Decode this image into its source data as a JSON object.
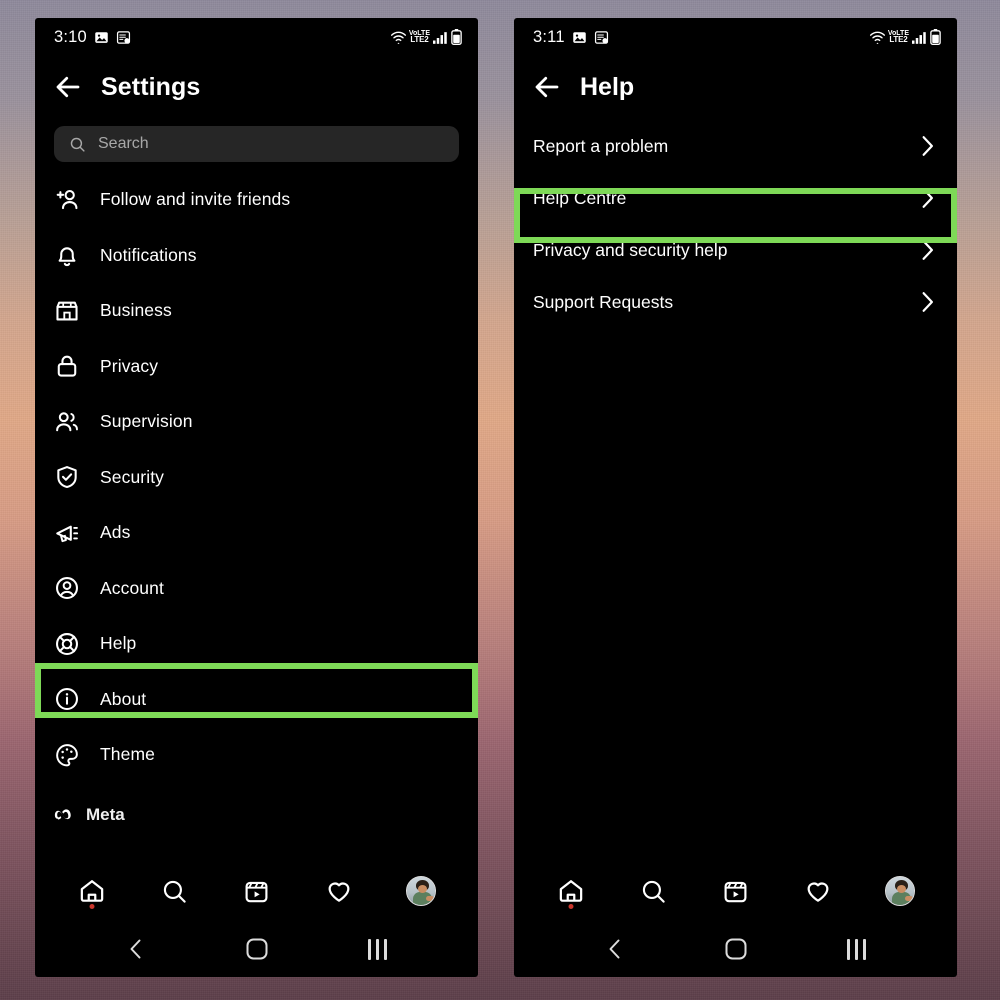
{
  "theme": {
    "accent_green": "#7ed957",
    "screen_bg": "#000000",
    "text_primary": "#ffffff",
    "text_muted": "#a8a8a8",
    "search_bg": "#262626",
    "notification_dot": "#c9362c"
  },
  "left_phone": {
    "status_bar": {
      "time": "3:10",
      "icons_left": [
        "image-icon",
        "screenshot-icon"
      ],
      "network_label_top": "VoLTE",
      "network_label_bottom": "LTE2",
      "icons_right": [
        "wifi-icon",
        "volte-indicator",
        "signal-bars-icon",
        "battery-icon"
      ]
    },
    "header": {
      "back_icon": "arrow-left-icon",
      "title": "Settings"
    },
    "search": {
      "icon": "search-icon",
      "placeholder": "Search",
      "value": ""
    },
    "items": [
      {
        "label": "Follow and invite friends",
        "icon": "add-person-icon"
      },
      {
        "label": "Notifications",
        "icon": "bell-icon"
      },
      {
        "label": "Business",
        "icon": "storefront-icon"
      },
      {
        "label": "Privacy",
        "icon": "lock-icon"
      },
      {
        "label": "Supervision",
        "icon": "people-icon"
      },
      {
        "label": "Security",
        "icon": "shield-check-icon"
      },
      {
        "label": "Ads",
        "icon": "megaphone-icon"
      },
      {
        "label": "Account",
        "icon": "account-circle-icon"
      },
      {
        "label": "Help",
        "icon": "lifebuoy-icon",
        "highlighted": true
      },
      {
        "label": "About",
        "icon": "info-circle-icon"
      },
      {
        "label": "Theme",
        "icon": "palette-icon"
      }
    ],
    "footer": {
      "brand_icon": "meta-infinity-icon",
      "brand_label": "Meta"
    },
    "tabbar": [
      {
        "name": "home",
        "icon": "home-icon",
        "badge_dot": true
      },
      {
        "name": "search",
        "icon": "search-icon",
        "badge_dot": false
      },
      {
        "name": "reels",
        "icon": "reels-icon",
        "badge_dot": false
      },
      {
        "name": "activity",
        "icon": "heart-icon",
        "badge_dot": false
      },
      {
        "name": "profile",
        "icon": "avatar-icon",
        "badge_dot": false
      }
    ],
    "navbar": [
      {
        "name": "back",
        "icon": "chevron-left-icon"
      },
      {
        "name": "home",
        "icon": "circle-icon"
      },
      {
        "name": "recents",
        "icon": "three-bars-icon"
      }
    ]
  },
  "right_phone": {
    "status_bar": {
      "time": "3:11",
      "icons_left": [
        "image-icon",
        "screenshot-icon"
      ],
      "network_label_top": "VoLTE",
      "network_label_bottom": "LTE2",
      "icons_right": [
        "wifi-icon",
        "volte-indicator",
        "signal-bars-icon",
        "battery-icon"
      ]
    },
    "header": {
      "back_icon": "arrow-left-icon",
      "title": "Help"
    },
    "items": [
      {
        "label": "Report a problem",
        "chevron": "chevron-right-icon"
      },
      {
        "label": "Help Centre",
        "chevron": "chevron-right-icon",
        "highlighted": true
      },
      {
        "label": "Privacy and security help",
        "chevron": "chevron-right-icon"
      },
      {
        "label": "Support Requests",
        "chevron": "chevron-right-icon"
      }
    ],
    "tabbar": [
      {
        "name": "home",
        "icon": "home-icon",
        "badge_dot": true
      },
      {
        "name": "search",
        "icon": "search-icon",
        "badge_dot": false
      },
      {
        "name": "reels",
        "icon": "reels-icon",
        "badge_dot": false
      },
      {
        "name": "activity",
        "icon": "heart-icon",
        "badge_dot": false
      },
      {
        "name": "profile",
        "icon": "avatar-icon",
        "badge_dot": false
      }
    ],
    "navbar": [
      {
        "name": "back",
        "icon": "chevron-left-icon"
      },
      {
        "name": "home",
        "icon": "circle-icon"
      },
      {
        "name": "recents",
        "icon": "three-bars-icon"
      }
    ]
  }
}
